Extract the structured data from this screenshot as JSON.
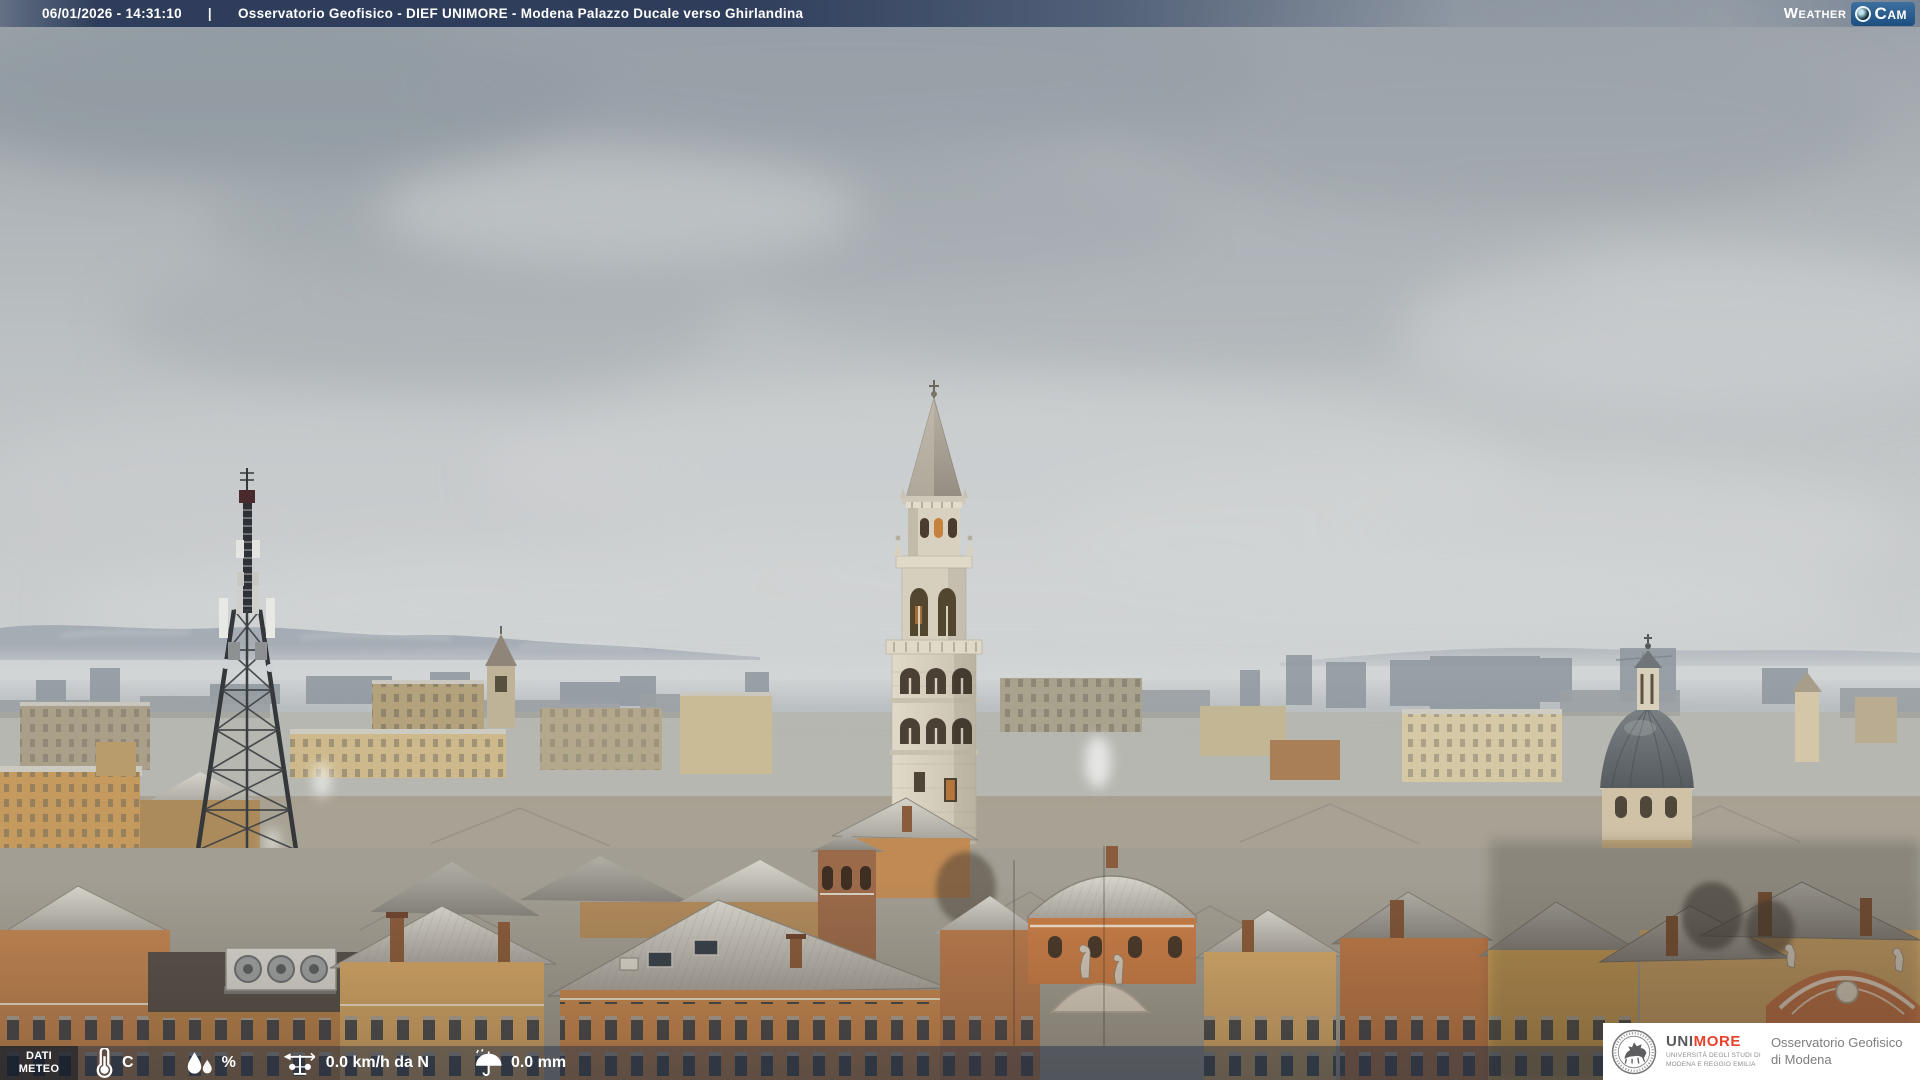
{
  "header": {
    "datetime": "06/01/2026 - 14:31:10",
    "separator": "|",
    "title": "Osservatorio Geofisico - DIEF UNIMORE - Modena Palazzo Ducale verso Ghirlandina",
    "logo": {
      "part1": "Weather",
      "part2": "Cam",
      "lens_icon": "camera-lens-icon"
    }
  },
  "footer": {
    "label_line1": "DATI",
    "label_line2": "METEO",
    "temperature": {
      "value": "",
      "unit": "C",
      "icon": "thermometer-icon"
    },
    "humidity": {
      "value": "",
      "unit": "%",
      "icon": "water-drops-icon"
    },
    "wind": {
      "value": "0.0 km/h da N",
      "icon": "wind-vane-icon"
    },
    "rain": {
      "value": "0.0 mm",
      "icon": "umbrella-icon"
    }
  },
  "branding": {
    "seal_icon": "unimore-seal-icon",
    "acronym_left": "UNI",
    "acronym_right": "MORE",
    "university_line1": "UNIVERSITÀ DEGLI STUDI DI",
    "university_line2": "MODENA E REGGIO EMILIA",
    "org_line1": "Osservatorio Geofisico",
    "org_line2": "di Modena"
  },
  "colors": {
    "header_bar": "#293856",
    "badge_blue": "#1c4e7f",
    "unimore_red": "#e8432a",
    "footer_overlay": "rgba(27,44,72,0.45)"
  },
  "scene": {
    "landmarks": [
      "ghirlandina-tower",
      "telecom-lattice-tower",
      "church-dome",
      "snowy-rooftops",
      "hazy-hills"
    ]
  }
}
